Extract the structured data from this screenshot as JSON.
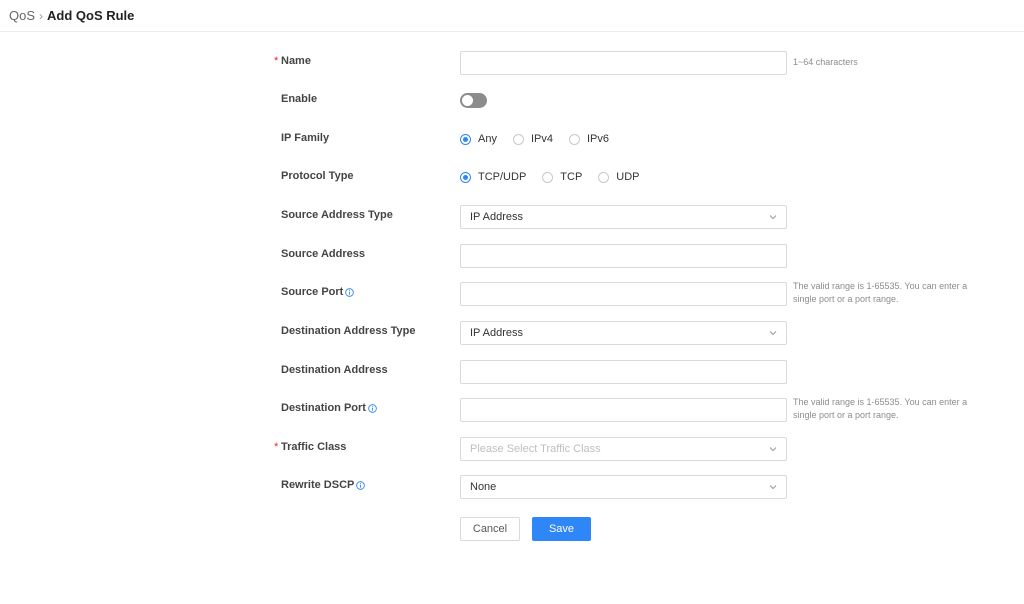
{
  "breadcrumb": {
    "root": "QoS",
    "separator": "›",
    "title": "Add QoS Rule"
  },
  "form": {
    "name": {
      "label": "Name",
      "value": "",
      "hint": "1~64 characters"
    },
    "enable": {
      "label": "Enable",
      "on": false
    },
    "ip_family": {
      "label": "IP Family",
      "options": [
        "Any",
        "IPv4",
        "IPv6"
      ],
      "selected": "Any"
    },
    "protocol_type": {
      "label": "Protocol Type",
      "options": [
        "TCP/UDP",
        "TCP",
        "UDP"
      ],
      "selected": "TCP/UDP"
    },
    "source_address_type": {
      "label": "Source Address Type",
      "value": "IP Address"
    },
    "source_address": {
      "label": "Source Address",
      "value": ""
    },
    "source_port": {
      "label": "Source Port",
      "value": "",
      "hint": "The valid range is 1-65535. You can enter a single port or a port range."
    },
    "destination_address_type": {
      "label": "Destination Address Type",
      "value": "IP Address"
    },
    "destination_address": {
      "label": "Destination Address",
      "value": ""
    },
    "destination_port": {
      "label": "Destination Port",
      "value": "",
      "hint": "The valid range is 1-65535. You can enter a single port or a port range."
    },
    "traffic_class": {
      "label": "Traffic Class",
      "placeholder": "Please Select Traffic Class"
    },
    "rewrite_dscp": {
      "label": "Rewrite DSCP",
      "value": "None"
    }
  },
  "buttons": {
    "cancel": "Cancel",
    "save": "Save"
  },
  "colors": {
    "accent": "#2f86f6",
    "required": "#f5222d",
    "toggle_off": "#8c8c8c"
  },
  "icons": [
    "chevron-right-icon",
    "info-icon",
    "chevron-down-icon"
  ]
}
